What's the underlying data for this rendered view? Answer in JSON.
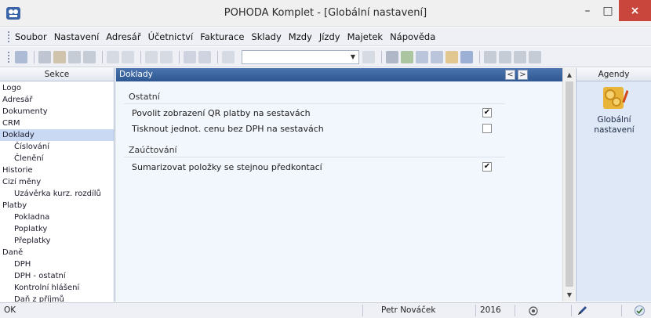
{
  "window": {
    "title": "POHODA Komplet - [Globální nastavení]",
    "close_glyph": "×",
    "minimize_glyph": "–",
    "maximize_glyph": "□"
  },
  "menu": {
    "items": [
      "Soubor",
      "Nastavení",
      "Adresář",
      "Účetnictví",
      "Fakturace",
      "Sklady",
      "Mzdy",
      "Jízdy",
      "Majetek",
      "Nápověda"
    ]
  },
  "toolbar": {
    "combo_value": ""
  },
  "sekce": {
    "header": "Sekce",
    "items": [
      {
        "label": "Logo",
        "sub": false,
        "selected": false
      },
      {
        "label": "Adresář",
        "sub": false,
        "selected": false
      },
      {
        "label": "Dokumenty",
        "sub": false,
        "selected": false
      },
      {
        "label": "CRM",
        "sub": false,
        "selected": false
      },
      {
        "label": "Doklady",
        "sub": false,
        "selected": true
      },
      {
        "label": "Číslování",
        "sub": true,
        "selected": false
      },
      {
        "label": "Členění",
        "sub": true,
        "selected": false
      },
      {
        "label": "Historie",
        "sub": false,
        "selected": false
      },
      {
        "label": "Cizí měny",
        "sub": false,
        "selected": false
      },
      {
        "label": "Uzávěrka kurz. rozdílů",
        "sub": true,
        "selected": false
      },
      {
        "label": "Platby",
        "sub": false,
        "selected": false
      },
      {
        "label": "Pokladna",
        "sub": true,
        "selected": false
      },
      {
        "label": "Poplatky",
        "sub": true,
        "selected": false
      },
      {
        "label": "Přeplatky",
        "sub": true,
        "selected": false
      },
      {
        "label": "Daně",
        "sub": false,
        "selected": false
      },
      {
        "label": "DPH",
        "sub": true,
        "selected": false
      },
      {
        "label": "DPH - ostatní",
        "sub": true,
        "selected": false
      },
      {
        "label": "Kontrolní hlášení",
        "sub": true,
        "selected": false
      },
      {
        "label": "Daň z příjmů",
        "sub": true,
        "selected": false
      }
    ]
  },
  "main": {
    "header": "Doklady",
    "nav_prev": "<",
    "nav_next": ">",
    "groups": [
      {
        "title": "Ostatní",
        "options": [
          {
            "label": "Povolit zobrazení QR platby na sestavách",
            "checked": true
          },
          {
            "label": "Tisknout jednot. cenu bez DPH na sestavách",
            "checked": false
          }
        ]
      },
      {
        "title": "Zaúčtování",
        "options": [
          {
            "label": "Sumarizovat položky se stejnou předkontací",
            "checked": true
          }
        ]
      }
    ]
  },
  "agendy": {
    "header": "Agendy",
    "tile_label_line1": "Globální",
    "tile_label_line2": "nastavení"
  },
  "status": {
    "left": "OK",
    "user": "Petr Nováček",
    "year": "2016"
  },
  "colors": {
    "header_blue": "#2f5892",
    "selected_row": "#c9d9f3",
    "close_red": "#c8463b"
  }
}
